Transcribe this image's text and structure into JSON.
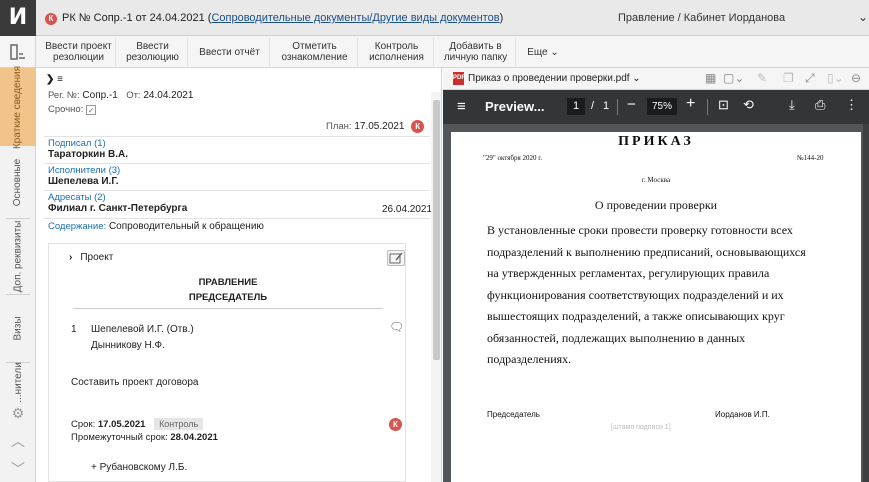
{
  "app": {
    "logo": "И"
  },
  "titlebar": {
    "doc_prefix": "РК № Сопр.-1 от 24.04.2021 (",
    "doc_link": "Сопроводительные документы/Другие виды документов",
    "doc_suffix": ")",
    "right_title": "Правление / Кабинет Иорданова",
    "badge": "К"
  },
  "toolbar": {
    "buttons": [
      "Ввести проект резолюции",
      "Ввести резолюцию",
      "Ввести отчёт",
      "Отметить ознакомление",
      "Контроль исполнения",
      "Добавить в личную папку",
      "Еще ⌄"
    ]
  },
  "sidebar": {
    "tabs": [
      "Краткие сведения",
      "Основные",
      "Доп. реквизиты",
      "Визы",
      "...нители"
    ]
  },
  "card": {
    "header_arrow": "❯ ≡",
    "reg_label": "Рег. №:",
    "reg_value": "Сопр.-1",
    "date_label": "От:",
    "date_value": "24.04.2021",
    "urgent_label": "Срочно:",
    "plan_label": "План:",
    "plan_value": "17.05.2021",
    "signed_label": "Подписал (1)",
    "signed_value": "Тараторкин В.А.",
    "exec_label": "Исполнители (3)",
    "exec_value": "Шепелева И.Г.",
    "addr_label": "Адресаты (2)",
    "addr_value": "Филиал г. Санкт-Петербурга",
    "addr_date": "26.04.2021",
    "content_label": "Содержание:",
    "content_value": "Сопроводительный к обращению"
  },
  "project": {
    "toggle": "Проект",
    "org": "ПРАВЛЕНИЕ",
    "position": "ПРЕДСЕДАТЕЛЬ",
    "item_num": "1",
    "item_exec": "Шепелевой И.Г.  (Отв.)",
    "item_exec2": "Дынникову Н.Ф.",
    "task": "Составить проект договора",
    "due_label": "Срок:",
    "due_value": "17.05.2021",
    "control": "Контроль",
    "interim_label": "Промежуточный срок:",
    "interim_value": "28.04.2021",
    "extra": "+ Рубановскому Л.Б."
  },
  "pdf": {
    "filename": "Приказ о проведении проверки.pdf ⌄",
    "preview": "Preview...",
    "page_current": "1",
    "page_sep": "/",
    "page_total": "1",
    "zoom": "75%",
    "doc_title": "ПРИКАЗ",
    "doc_date": "\"29\" октября 2020 г.",
    "doc_num": "№144-20",
    "doc_city": "г. Москва",
    "doc_subject": "О проведении проверки",
    "doc_body": [
      "В установленные сроки провести проверку готовности всех",
      "подразделений к выполнению предписаний, основывающихся",
      "на утвержденных регламентах, регулирующих правила",
      "функционирования соответствующих подразделений и их",
      "вышестоящих подразделений, а также описывающих круг",
      "обязанностей, подлежащих выполнению в данных",
      "подразделениях."
    ],
    "sign_role": "Председатель",
    "sign_stamp": "[штамп подписи 1]",
    "sign_name": "Иорданов И.П."
  }
}
